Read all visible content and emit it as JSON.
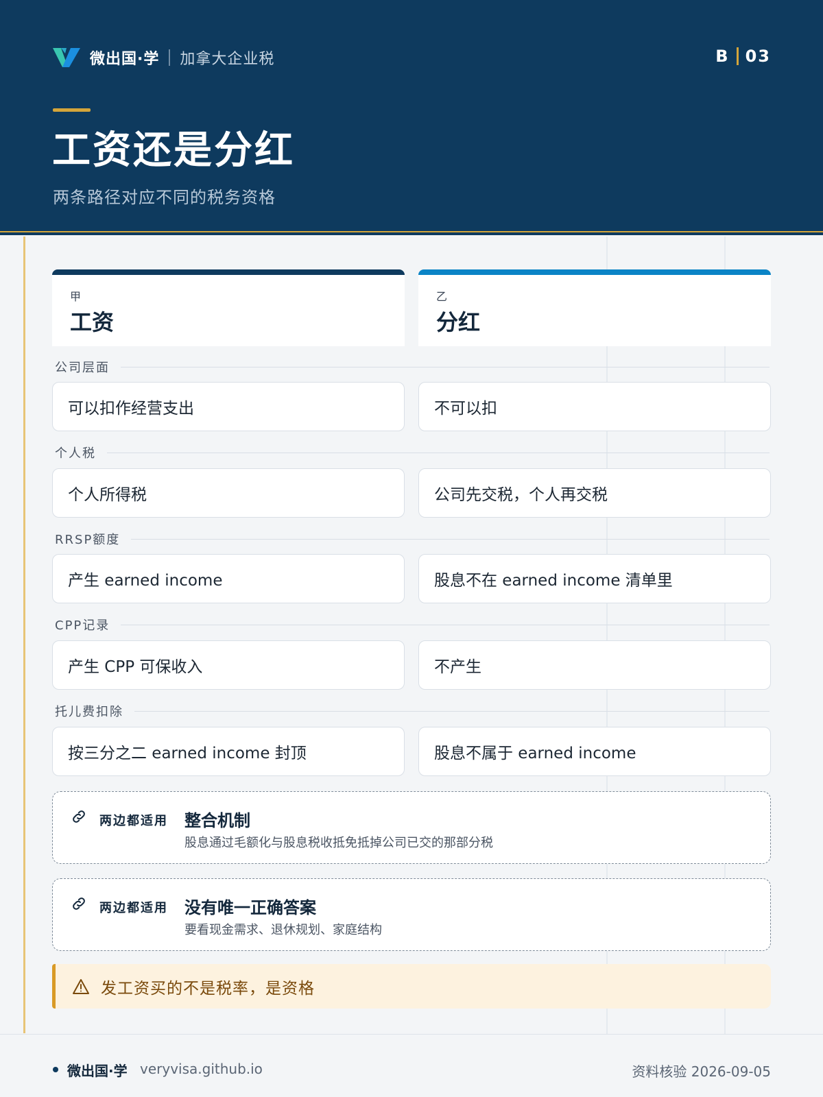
{
  "header": {
    "brand": "微出国·学",
    "section": "加拿大企业税",
    "page_letter": "B",
    "page_number": "03",
    "title": "工资还是分红",
    "subtitle": "两条路径对应不同的税务资格"
  },
  "columns": [
    {
      "tag": "甲",
      "name": "工资"
    },
    {
      "tag": "乙",
      "name": "分红"
    }
  ],
  "rows": [
    {
      "label": "公司层面",
      "left": "可以扣作经营支出",
      "right": "不可以扣"
    },
    {
      "label": "个人税",
      "left": "个人所得税",
      "right": "公司先交税，个人再交税"
    },
    {
      "label": "RRSP额度",
      "left": "产生 earned income",
      "right": "股息不在 earned income 清单里"
    },
    {
      "label": "CPP记录",
      "left": "产生 CPP 可保收入",
      "right": "不产生"
    },
    {
      "label": "托儿费扣除",
      "left": "按三分之二 earned income 封顶",
      "right": "股息不属于 earned income"
    }
  ],
  "notes": [
    {
      "badge": "两边都适用",
      "title": "整合机制",
      "desc": "股息通过毛额化与股息税收抵免抵掉公司已交的那部分税",
      "icon": "link-icon"
    },
    {
      "badge": "两边都适用",
      "title": "没有唯一正确答案",
      "desc": "要看现金需求、退休规划、家庭结构",
      "icon": "link-icon"
    }
  ],
  "warning": {
    "text": "发工资买的不是税率，是资格",
    "icon": "warning-icon"
  },
  "footer": {
    "brand": "微出国·学",
    "url": "veryvisa.github.io",
    "verified": "资料核验 2026-09-05"
  },
  "colors": {
    "navy": "#0e3a5e",
    "gold": "#d4a53a",
    "blue": "#0b84c6",
    "warn_bg": "#fdf2df"
  }
}
